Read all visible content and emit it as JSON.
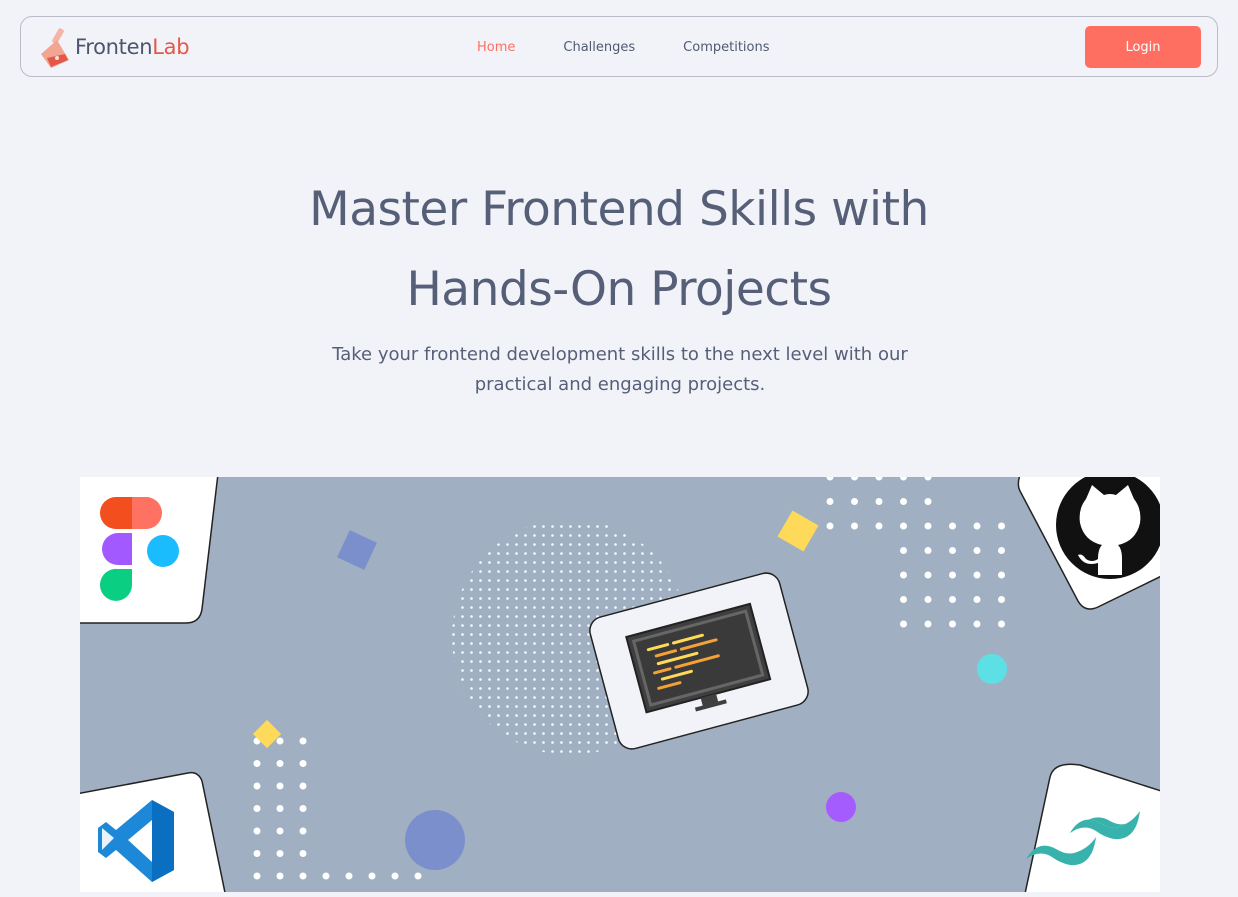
{
  "brand": {
    "name_part1": "Fronten",
    "name_part2": "Lab"
  },
  "nav": {
    "links": [
      {
        "label": "Home",
        "active": true
      },
      {
        "label": "Challenges",
        "active": false
      },
      {
        "label": "Competitions",
        "active": false
      }
    ],
    "login_label": "Login"
  },
  "hero": {
    "title_line1": "Master Frontend Skills with",
    "title_line2": "Hands-On Projects",
    "subtitle_line1": "Take your frontend development skills to the next level with our",
    "subtitle_line2": "practical and engaging projects."
  },
  "illustration": {
    "icons": [
      "figma-icon",
      "github-icon",
      "vscode-icon",
      "tailwind-icon",
      "code-monitor-icon"
    ]
  },
  "colors": {
    "accent": "#ff6f61",
    "text": "#555f78",
    "background": "#f2f3f8",
    "banner": "#a0b0c2"
  }
}
